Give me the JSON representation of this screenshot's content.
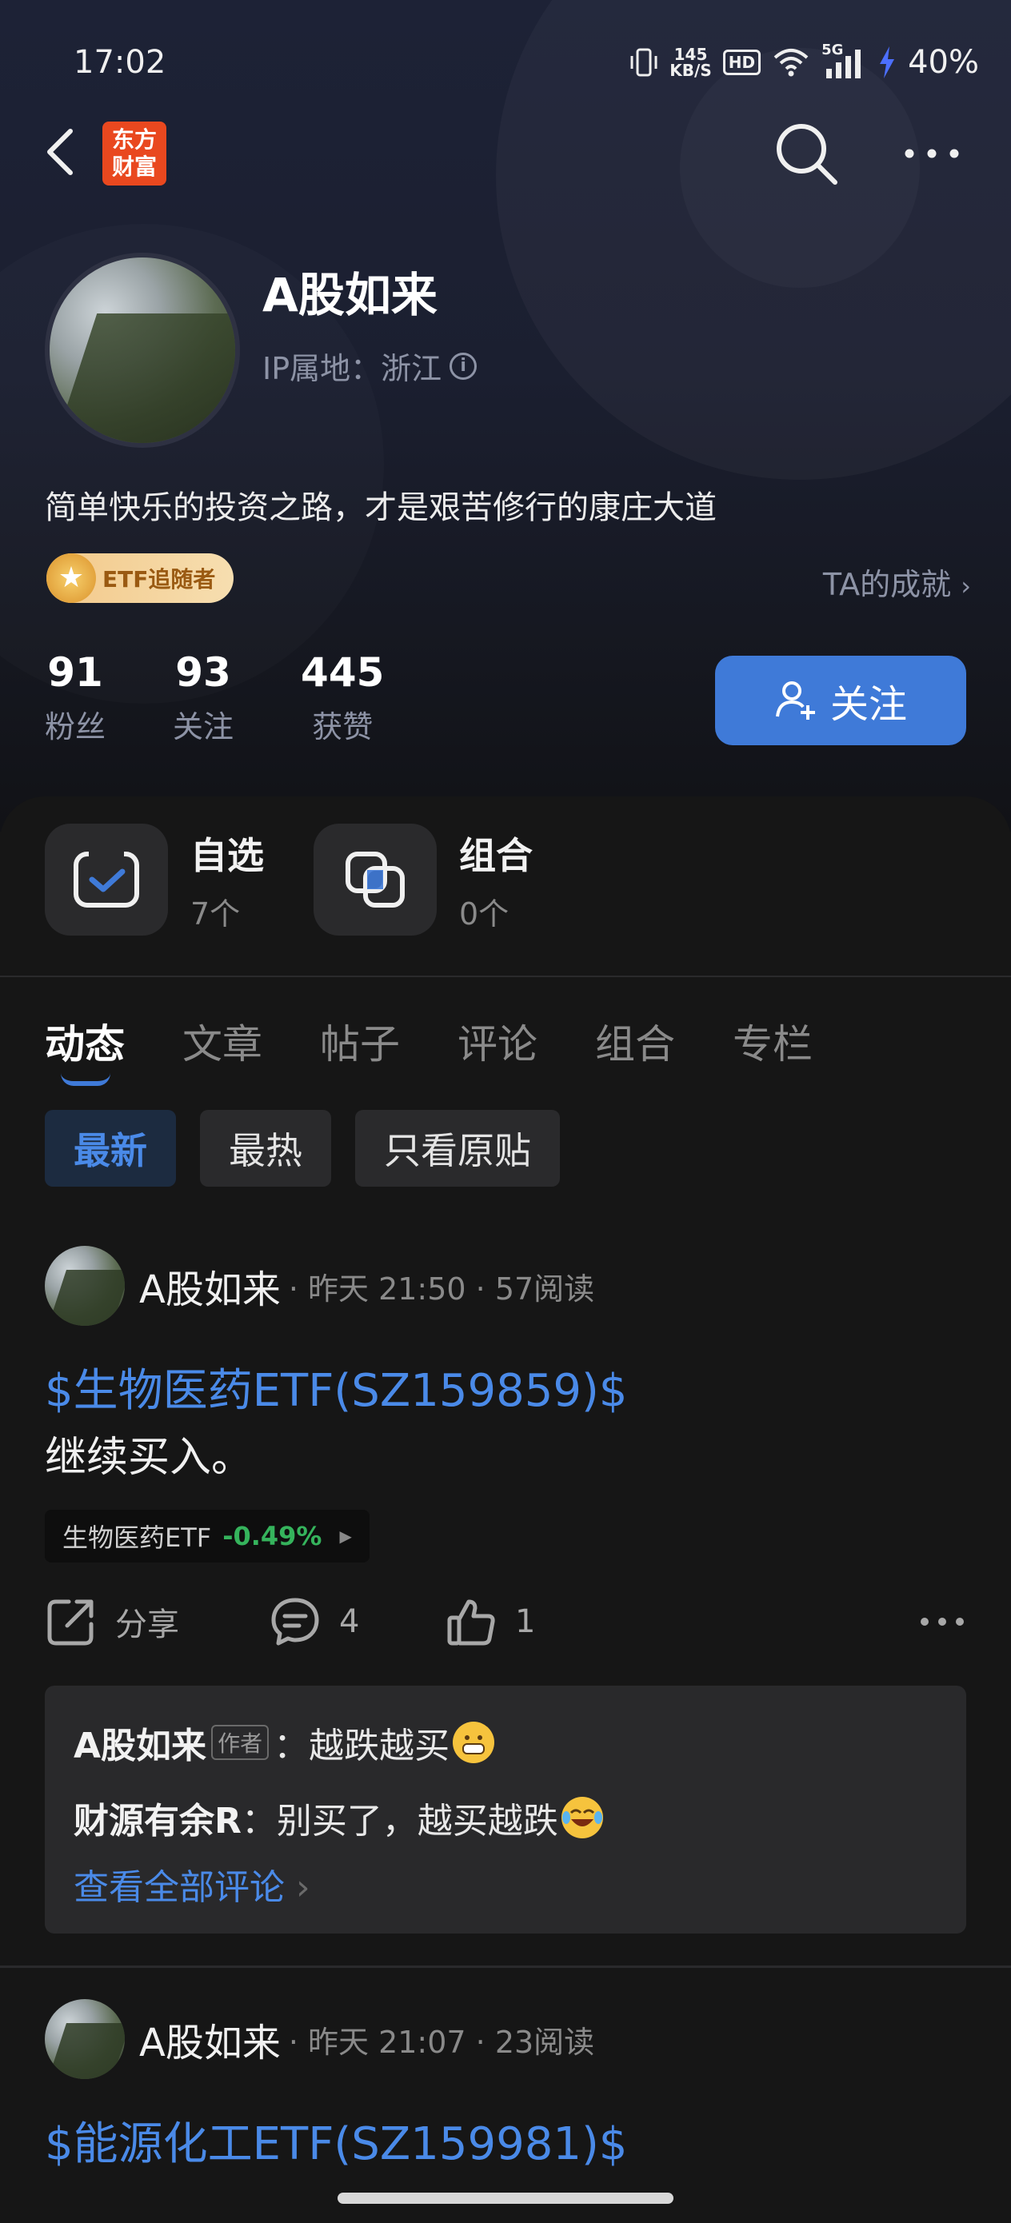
{
  "status_bar": {
    "time": "17:02",
    "net_speed_value": "145",
    "net_speed_unit": "KB/S",
    "hd": "HD",
    "network": "5G",
    "battery": "40%",
    "icons": [
      "vibrate-icon",
      "wifi-icon",
      "signal-icon",
      "charging-icon"
    ]
  },
  "nav": {
    "logo_line1": "东方",
    "logo_line2": "财富",
    "icons": [
      "back-icon",
      "search-icon",
      "more-icon"
    ]
  },
  "profile": {
    "name": "A股如来",
    "ip_location": "IP属地：浙江",
    "bio": "简单快乐的投资之路，才是艰苦修行的康庄大道",
    "badge": "ETF追随者",
    "achievements_link": "TA的成就",
    "stats": [
      {
        "num": "91",
        "label": "粉丝"
      },
      {
        "num": "93",
        "label": "关注"
      },
      {
        "num": "445",
        "label": "获赞"
      }
    ],
    "follow_button": "关注"
  },
  "shortcuts": [
    {
      "title": "自选",
      "count": "7个"
    },
    {
      "title": "组合",
      "count": "0个"
    }
  ],
  "tabs": [
    "动态",
    "文章",
    "帖子",
    "评论",
    "组合",
    "专栏"
  ],
  "active_tab": "动态",
  "filters": [
    "最新",
    "最热",
    "只看原贴"
  ],
  "active_filter": "最新",
  "posts": [
    {
      "author": "A股如来",
      "meta": "· 昨天 21:50 · 57阅读",
      "link": "$生物医药ETF(SZ159859)$",
      "text": "继续买入。",
      "quote_name": "生物医药ETF",
      "quote_change": "-0.49%",
      "share_label": "分享",
      "comment_count": "4",
      "like_count": "1",
      "comments": [
        {
          "user": "A股如来",
          "tag": "作者",
          "sep": "：",
          "text": "越跌越买"
        },
        {
          "user": "财源有余R",
          "sep": "：",
          "text": "别买了，越买越跌"
        }
      ],
      "view_all": "查看全部评论"
    },
    {
      "author": "A股如来",
      "meta": "· 昨天 21:07 · 23阅读",
      "link": "$能源化工ETF(SZ159981)$"
    }
  ],
  "colors": {
    "accent": "#3f7ad8",
    "link": "#4a8ae8",
    "down": "#35b35c",
    "background": "#161616"
  }
}
